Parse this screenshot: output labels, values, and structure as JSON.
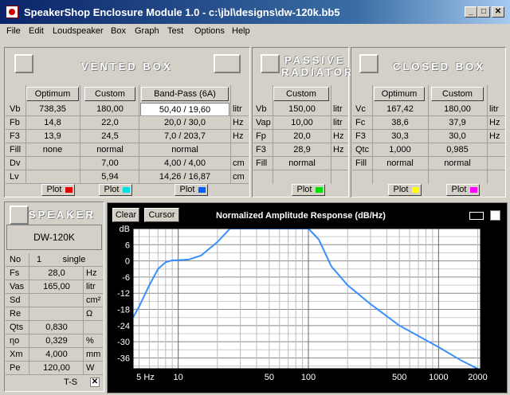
{
  "window": {
    "title": "SpeakerShop Enclosure Module 1.0 - c:\\jbl\\designs\\dw-120k.bb5"
  },
  "menu": [
    "File",
    "Edit",
    "Loudspeaker",
    "Box",
    "Graph",
    "Test",
    "Options",
    "Help"
  ],
  "vented": {
    "header": "VENTED BOX",
    "cols": [
      "Optimum",
      "Custom",
      "Band-Pass (6A)"
    ],
    "rows": [
      {
        "label": "Vb",
        "vals": [
          "738,35",
          "180,00",
          "50,40 / 19,60"
        ],
        "unit": "litr"
      },
      {
        "label": "Fb",
        "vals": [
          "14,8",
          "22,0",
          "20,0 / 30,0"
        ],
        "unit": "Hz"
      },
      {
        "label": "F3",
        "vals": [
          "13,9",
          "24,5",
          "7,0 / 203,7"
        ],
        "unit": "Hz"
      },
      {
        "label": "Fill",
        "vals": [
          "none",
          "normal",
          "normal"
        ],
        "unit": ""
      },
      {
        "label": "Dv",
        "vals": [
          "",
          "7,00",
          "4,00 / 4,00"
        ],
        "unit": "cm"
      },
      {
        "label": "Lv",
        "vals": [
          "",
          "5,94",
          "14,26 / 16,87"
        ],
        "unit": "cm"
      }
    ],
    "plot_label": "Plot",
    "plot_colors": [
      "#e00000",
      "#00e0e0",
      "#0060ff"
    ]
  },
  "passive": {
    "header1": "PASSIVE",
    "header2": "RADIATOR",
    "col": "Custom",
    "rows": [
      {
        "label": "Vb",
        "val": "150,00",
        "unit": "litr"
      },
      {
        "label": "Vap",
        "val": "10,00",
        "unit": "litr"
      },
      {
        "label": "Fp",
        "val": "20,0",
        "unit": "Hz"
      },
      {
        "label": "F3",
        "val": "28,9",
        "unit": "Hz"
      },
      {
        "label": "Fill",
        "val": "normal",
        "unit": ""
      }
    ],
    "plot_label": "Plot",
    "plot_color": "#00e000"
  },
  "closed": {
    "header": "CLOSED BOX",
    "cols": [
      "Optimum",
      "Custom"
    ],
    "rows": [
      {
        "label": "Vc",
        "vals": [
          "167,42",
          "180,00"
        ],
        "unit": "litr"
      },
      {
        "label": "Fc",
        "vals": [
          "38,6",
          "37,9"
        ],
        "unit": "Hz"
      },
      {
        "label": "F3",
        "vals": [
          "30,3",
          "30,0"
        ],
        "unit": "Hz"
      },
      {
        "label": "Qtc",
        "vals": [
          "1,000",
          "0,985"
        ],
        "unit": ""
      },
      {
        "label": "Fill",
        "vals": [
          "normal",
          "normal"
        ],
        "unit": ""
      }
    ],
    "plot_label": "Plot",
    "plot_colors": [
      "#ffff00",
      "#ff00ff"
    ]
  },
  "speaker": {
    "header": "SPEAKER",
    "name": "DW-120K",
    "no_label": "No",
    "no_val": "1",
    "no_mode": "single",
    "rows": [
      {
        "label": "Fs",
        "val": "28,0",
        "unit": "Hz"
      },
      {
        "label": "Vas",
        "val": "165,00",
        "unit": "litr"
      },
      {
        "label": "Sd",
        "val": "",
        "unit": "cm²"
      },
      {
        "label": "Re",
        "val": "",
        "unit": "Ω"
      },
      {
        "label": "Qts",
        "val": "0,830",
        "unit": ""
      },
      {
        "label": "ηo",
        "val": "0,329",
        "unit": "%"
      },
      {
        "label": "Xm",
        "val": "4,000",
        "unit": "mm"
      },
      {
        "label": "Pe",
        "val": "120,00",
        "unit": "W"
      }
    ],
    "ts_label": "T-S",
    "ts_checked": "✕"
  },
  "graph": {
    "clear": "Clear",
    "cursor": "Cursor",
    "title": "Normalized Amplitude Response (dB/Hz)",
    "db_label": "dB",
    "y_ticks": [
      "6",
      "0",
      "-6",
      "-12",
      "-18",
      "-24",
      "-30",
      "-36"
    ],
    "x_ticks": [
      "5 Hz",
      "10",
      "50",
      "100",
      "500",
      "1000",
      "2000"
    ]
  },
  "chart_data": {
    "type": "line",
    "title": "Normalized Amplitude Response (dB/Hz)",
    "ylabel": "dB",
    "xscale": "log",
    "xlim": [
      4.5,
      2100
    ],
    "ylim": [
      -40,
      12
    ],
    "series": [
      {
        "color": "#3a8fff",
        "x": [
          4.5,
          5,
          6,
          7,
          8,
          9,
          10,
          12,
          15,
          20,
          25,
          30,
          40,
          50,
          60,
          70,
          80,
          100,
          120,
          150,
          200,
          300,
          500,
          1000,
          1500,
          2000
        ],
        "y": [
          -21,
          -17,
          -9,
          -3,
          -0.5,
          0.2,
          0.3,
          0.5,
          2,
          7,
          16,
          30,
          13,
          12,
          12,
          14,
          30,
          22,
          8,
          -2,
          -9,
          -16,
          -24,
          -32,
          -37,
          -40
        ]
      }
    ],
    "grid": true
  }
}
